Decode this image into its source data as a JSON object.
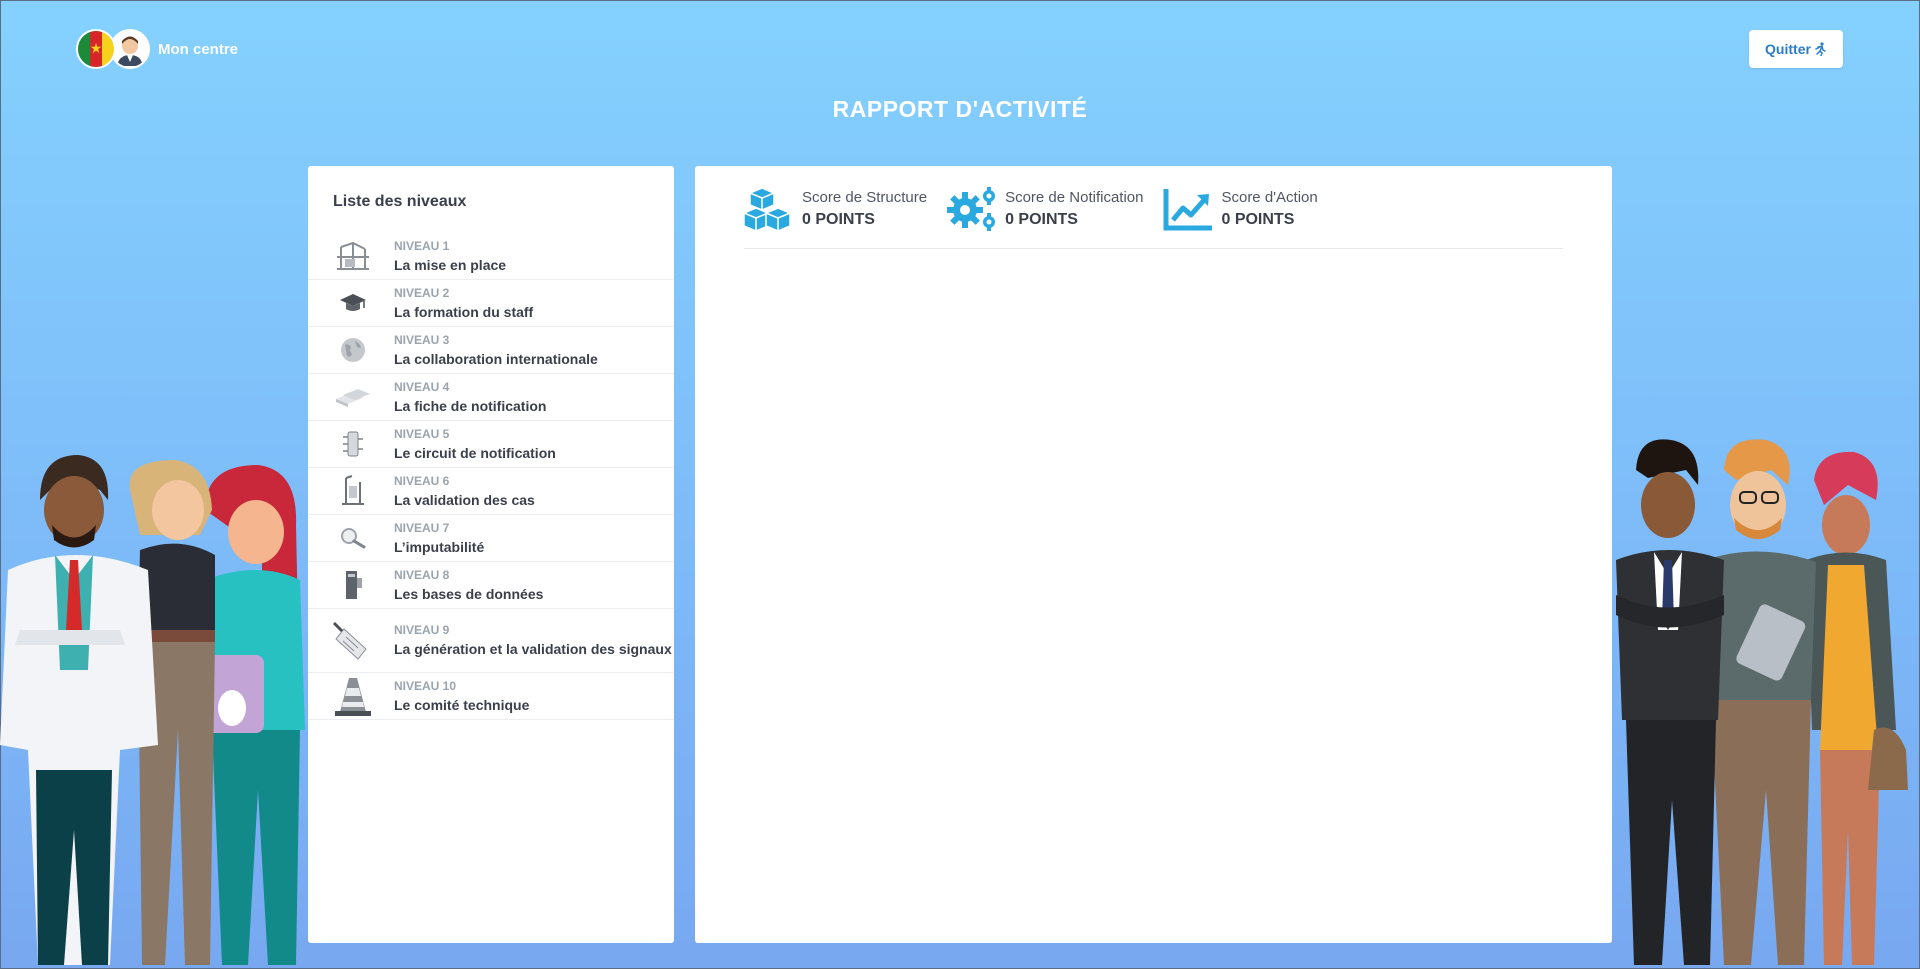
{
  "header": {
    "centre_label": "Mon centre",
    "quit_label": "Quitter",
    "title": "RAPPORT D'ACTIVITÉ"
  },
  "levels_panel": {
    "title": "Liste des niveaux",
    "items": [
      {
        "num": "NIVEAU 1",
        "name": "La mise en place",
        "icon": "scaffold-icon"
      },
      {
        "num": "NIVEAU 2",
        "name": "La formation du staff",
        "icon": "graduation-cap-icon"
      },
      {
        "num": "NIVEAU 3",
        "name": "La collaboration internationale",
        "icon": "globe-icon"
      },
      {
        "num": "NIVEAU 4",
        "name": "La fiche de notification",
        "icon": "documents-icon"
      },
      {
        "num": "NIVEAU 5",
        "name": "Le circuit de notification",
        "icon": "circuit-icon"
      },
      {
        "num": "NIVEAU 6",
        "name": "La validation des cas",
        "icon": "validation-icon"
      },
      {
        "num": "NIVEAU 7",
        "name": "L’imputabilité",
        "icon": "magnifier-icon"
      },
      {
        "num": "NIVEAU 8",
        "name": "Les bases de données",
        "icon": "database-icon"
      },
      {
        "num": "NIVEAU 9",
        "name": "La génération et la validation des signaux",
        "icon": "signal-icon"
      },
      {
        "num": "NIVEAU 10",
        "name": "Le comité technique",
        "icon": "cone-icon"
      }
    ]
  },
  "scores": [
    {
      "label": "Score de Structure",
      "value": "0 POINTS",
      "icon": "cubes-icon"
    },
    {
      "label": "Score de Notification",
      "value": "0 POINTS",
      "icon": "gears-icon"
    },
    {
      "label": "Score d'Action",
      "value": "0 POINTS",
      "icon": "trend-chart-icon"
    }
  ],
  "colors": {
    "accent": "#2aa8e0",
    "quit_text": "#2a7dc9",
    "background_top": "#84d1fe",
    "background_bottom": "#78a8f0"
  }
}
